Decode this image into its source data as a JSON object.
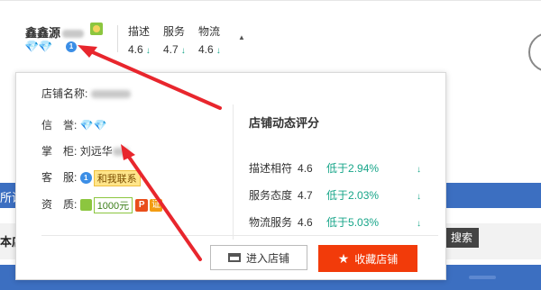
{
  "shop": {
    "name": "鑫鑫源",
    "diamonds": "💎💎",
    "ww_icon": "wangwang-icon",
    "badge": "1"
  },
  "scores": [
    {
      "label": "描述",
      "value": "4.6",
      "arrow": "↓"
    },
    {
      "label": "服务",
      "value": "4.7",
      "arrow": "↓"
    },
    {
      "label": "物流",
      "value": "4.6",
      "arrow": "↓"
    }
  ],
  "popup": {
    "shop_name_label": "店铺名称:",
    "credit_label": "信　誉:",
    "credit_value": "💎💎",
    "owner_label": "掌　柜:",
    "owner_value": "刘远华",
    "cs_label": "客　服:",
    "cs_badge": "1",
    "cs_contact": "和我联系",
    "qual_label": "资　质:",
    "deposit": "1000元",
    "p_icon": "P",
    "zheng_icon": "证",
    "dyn_title": "店铺动态评分",
    "dyn_rows": [
      {
        "label": "描述相符",
        "value": "4.6",
        "compare": "低于2.94%",
        "arrow": "↓"
      },
      {
        "label": "服务态度",
        "value": "4.7",
        "compare": "低于2.03%",
        "arrow": "↓"
      },
      {
        "label": "物流服务",
        "value": "4.6",
        "compare": "低于5.03%",
        "arrow": "↓"
      }
    ],
    "enter_button": "进入店铺",
    "fav_button": "收藏店铺"
  },
  "background": {
    "blue_bar_text": "所谁",
    "left_text": "本店",
    "search_button": "搜索"
  },
  "colors": {
    "accent_red": "#f23b0a",
    "down_green": "#17a589",
    "arrow_red": "#e8262d",
    "blue_bar": "#3c6fc1"
  }
}
